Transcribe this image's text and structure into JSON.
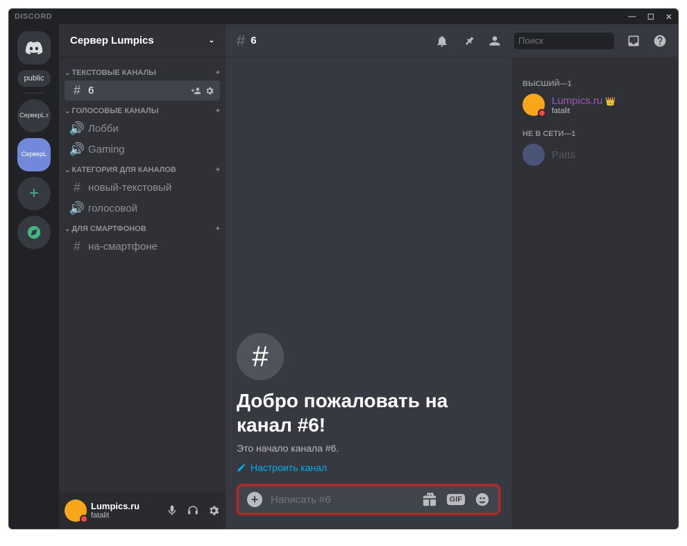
{
  "titlebar": {
    "brand": "DISCORD"
  },
  "server": {
    "name": "Сервер Lumpics",
    "servers_list": {
      "public": "public",
      "s1": "СерверL.r",
      "s2": "СерверL"
    }
  },
  "categories": [
    {
      "label": "ТЕКСТОВЫЕ КАНАЛЫ",
      "channels": [
        {
          "type": "text",
          "name": "6",
          "selected": true
        }
      ]
    },
    {
      "label": "ГОЛОСОВЫЕ КАНАЛЫ",
      "channels": [
        {
          "type": "voice",
          "name": "Лобби"
        },
        {
          "type": "voice",
          "name": "Gaming"
        }
      ]
    },
    {
      "label": "КАТЕГОРИЯ ДЛЯ КАНАЛОВ",
      "channels": [
        {
          "type": "text",
          "name": "новый-текстовый"
        },
        {
          "type": "voice",
          "name": "голосовой"
        }
      ]
    },
    {
      "label": "ДЛЯ СМАРТФОНОВ",
      "channels": [
        {
          "type": "text",
          "name": "на-смартфоне"
        }
      ]
    }
  ],
  "user_panel": {
    "name": "Lumpics.ru",
    "tag": "fatalit"
  },
  "channel_header": {
    "name": "6"
  },
  "search": {
    "placeholder": "Поиск"
  },
  "welcome": {
    "title_line1": "Добро пожаловать на",
    "title_line2": "канал #6!",
    "subtitle": "Это начало канала #6.",
    "edit_link": "Настроить канал"
  },
  "composer": {
    "placeholder": "Написать #6",
    "gif": "GIF"
  },
  "members": {
    "group1": {
      "label": "ВЫСШИЙ—1",
      "items": [
        {
          "name": "Lumpics.ru",
          "sub": "fatalit",
          "owner": true,
          "color": "c1"
        }
      ]
    },
    "group2": {
      "label": "НЕ В СЕТИ—1",
      "items": [
        {
          "name": "Patts"
        }
      ]
    }
  }
}
